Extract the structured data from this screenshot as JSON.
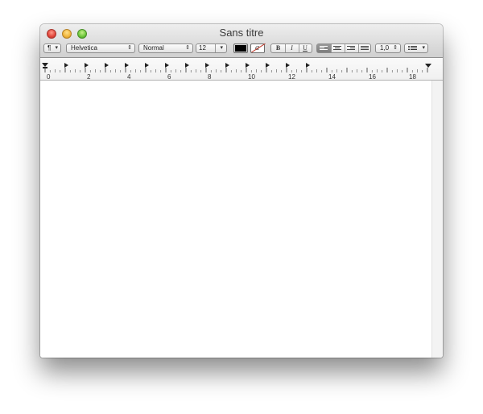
{
  "window": {
    "title": "Sans titre"
  },
  "toolbar": {
    "paragraph_style_icon": "pilcrow-icon",
    "paragraph_style_label": "¶",
    "font_family": "Helvetica",
    "font_style": "Normal",
    "font_size": "12",
    "text_color": "#000000",
    "highlight_glyph": "a",
    "highlight_color": "#c0392b",
    "bold_label": "B",
    "italic_label": "I",
    "underline_label": "U",
    "alignment_selected": "left",
    "line_spacing": "1,0",
    "list_icon": "list-bullets-icon"
  },
  "ruler": {
    "labels": [
      "0",
      "2",
      "4",
      "6",
      "8",
      "10",
      "12",
      "14",
      "16",
      "18"
    ],
    "tab_stop_count": 13
  }
}
